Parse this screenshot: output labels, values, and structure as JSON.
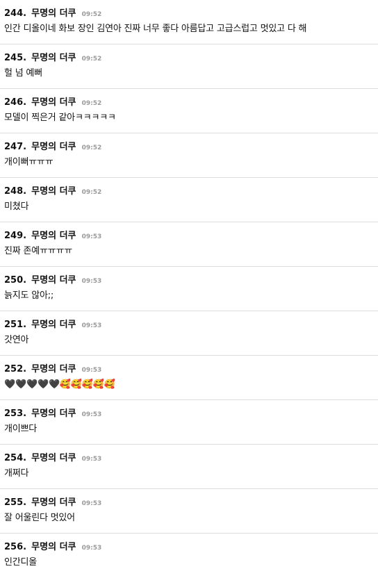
{
  "comments": [
    {
      "number": "244.",
      "author": "무명의 더쿠",
      "time": "09:52",
      "text": "인간 디올이네 화보 장인 김연아 진짜 너무 좋다 아름답고 고급스럽고 멋있고 다 해"
    },
    {
      "number": "245.",
      "author": "무명의 더쿠",
      "time": "09:52",
      "text": "헐 넘 예뻐"
    },
    {
      "number": "246.",
      "author": "무명의 더쿠",
      "time": "09:52",
      "text": "모델이 찍은거 같아ㅋㅋㅋㅋㅋ"
    },
    {
      "number": "247.",
      "author": "무명의 더쿠",
      "time": "09:52",
      "text": "개이뻐ㅠㅠㅠ"
    },
    {
      "number": "248.",
      "author": "무명의 더쿠",
      "time": "09:52",
      "text": "미쳤다"
    },
    {
      "number": "249.",
      "author": "무명의 더쿠",
      "time": "09:53",
      "text": "진짜 존예ㅠㅠㅠㅠ"
    },
    {
      "number": "250.",
      "author": "무명의 더쿠",
      "time": "09:53",
      "text": "늙지도 않아;;"
    },
    {
      "number": "251.",
      "author": "무명의 더쿠",
      "time": "09:53",
      "text": "갓연아"
    },
    {
      "number": "252.",
      "author": "무명의 더쿠",
      "time": "09:53",
      "text": "🖤🖤🖤🖤🖤🥰🥰🥰🥰🥰"
    },
    {
      "number": "253.",
      "author": "무명의 더쿠",
      "time": "09:53",
      "text": "개이쁘다"
    },
    {
      "number": "254.",
      "author": "무명의 더쿠",
      "time": "09:53",
      "text": "개쩌다"
    },
    {
      "number": "255.",
      "author": "무명의 더쿠",
      "time": "09:53",
      "text": "잘 어울린다 멋있어"
    },
    {
      "number": "256.",
      "author": "무명의 더쿠",
      "time": "09:53",
      "text": "인간디올"
    }
  ]
}
